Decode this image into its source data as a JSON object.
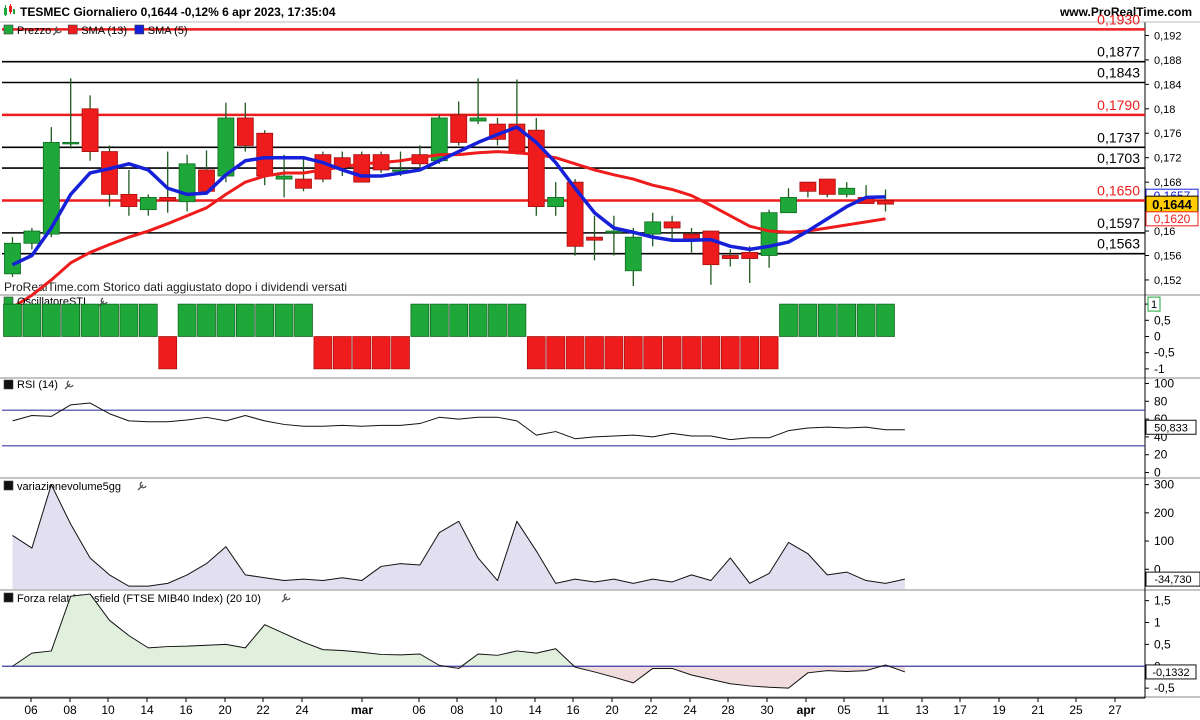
{
  "header": {
    "title": "TESMEC Giornaliero 0,1644 -0,12% 6 apr 2023, 17:35:04",
    "site": "www.ProRealTime.com"
  },
  "colors": {
    "up": "#1fa83a",
    "down": "#ee1c1c",
    "sma13": "#ee1c1c",
    "sma5": "#1520d8",
    "hline_red": "#ee1c1c",
    "hline_black": "#000000",
    "rsi_band": "#3a3aa0",
    "vol_fill": "#e2e0f0",
    "mansfield_pos": "#e0f0dc",
    "mansfield_neg": "#f0dcdc",
    "price_tag_bg": "#ffcc00"
  },
  "chart_data": [
    {
      "panel": "price",
      "type": "candlestick",
      "legend": [
        "Prezzo",
        "SMA (13)",
        "SMA (5)"
      ],
      "watermark": "ProRealTime.com Storico dati aggiustato dopo i dividendi versati",
      "y_ticks": [
        0.152,
        0.156,
        0.16,
        0.164,
        0.168,
        0.172,
        0.176,
        0.18,
        0.184,
        0.188,
        0.192
      ],
      "y_tick_labels": [
        "0,152",
        "0,156",
        "0,16",
        "0,164",
        "0,168",
        "0,172",
        "0,176",
        "0,18",
        "0,184",
        "0,188",
        "0,192"
      ],
      "ylim": [
        0.1497,
        0.1942
      ],
      "candles": [
        {
          "o": 0.153,
          "h": 0.159,
          "l": 0.1525,
          "c": 0.158
        },
        {
          "o": 0.158,
          "h": 0.1605,
          "l": 0.157,
          "c": 0.16
        },
        {
          "o": 0.1595,
          "h": 0.177,
          "l": 0.159,
          "c": 0.1745
        },
        {
          "o": 0.1745,
          "h": 0.185,
          "l": 0.1735,
          "c": 0.1745
        },
        {
          "o": 0.18,
          "h": 0.1822,
          "l": 0.1715,
          "c": 0.173
        },
        {
          "o": 0.173,
          "h": 0.174,
          "l": 0.164,
          "c": 0.166
        },
        {
          "o": 0.166,
          "h": 0.17,
          "l": 0.1625,
          "c": 0.164
        },
        {
          "o": 0.1635,
          "h": 0.166,
          "l": 0.1625,
          "c": 0.1655
        },
        {
          "o": 0.1655,
          "h": 0.173,
          "l": 0.163,
          "c": 0.165
        },
        {
          "o": 0.1648,
          "h": 0.1725,
          "l": 0.1632,
          "c": 0.171
        },
        {
          "o": 0.17,
          "h": 0.1732,
          "l": 0.1665,
          "c": 0.1665
        },
        {
          "o": 0.169,
          "h": 0.181,
          "l": 0.168,
          "c": 0.1785
        },
        {
          "o": 0.1785,
          "h": 0.181,
          "l": 0.173,
          "c": 0.174
        },
        {
          "o": 0.176,
          "h": 0.1765,
          "l": 0.1675,
          "c": 0.169
        },
        {
          "o": 0.1685,
          "h": 0.1725,
          "l": 0.1655,
          "c": 0.169
        },
        {
          "o": 0.1685,
          "h": 0.172,
          "l": 0.1665,
          "c": 0.167
        },
        {
          "o": 0.1725,
          "h": 0.173,
          "l": 0.168,
          "c": 0.1685
        },
        {
          "o": 0.172,
          "h": 0.173,
          "l": 0.169,
          "c": 0.1705
        },
        {
          "o": 0.1725,
          "h": 0.173,
          "l": 0.168,
          "c": 0.168
        },
        {
          "o": 0.1725,
          "h": 0.173,
          "l": 0.1695,
          "c": 0.17
        },
        {
          "o": 0.17,
          "h": 0.173,
          "l": 0.169,
          "c": 0.17
        },
        {
          "o": 0.1725,
          "h": 0.174,
          "l": 0.1705,
          "c": 0.171
        },
        {
          "o": 0.1715,
          "h": 0.179,
          "l": 0.171,
          "c": 0.1785
        },
        {
          "o": 0.179,
          "h": 0.1812,
          "l": 0.174,
          "c": 0.1745
        },
        {
          "o": 0.178,
          "h": 0.185,
          "l": 0.1775,
          "c": 0.1785
        },
        {
          "o": 0.1775,
          "h": 0.1785,
          "l": 0.174,
          "c": 0.175
        },
        {
          "o": 0.1775,
          "h": 0.1848,
          "l": 0.1725,
          "c": 0.173
        },
        {
          "o": 0.1765,
          "h": 0.1785,
          "l": 0.1625,
          "c": 0.164
        },
        {
          "o": 0.164,
          "h": 0.168,
          "l": 0.1625,
          "c": 0.1655
        },
        {
          "o": 0.168,
          "h": 0.1685,
          "l": 0.156,
          "c": 0.1575
        },
        {
          "o": 0.159,
          "h": 0.1625,
          "l": 0.1552,
          "c": 0.1585
        },
        {
          "o": 0.16,
          "h": 0.1625,
          "l": 0.156,
          "c": 0.16
        },
        {
          "o": 0.1535,
          "h": 0.1605,
          "l": 0.151,
          "c": 0.159
        },
        {
          "o": 0.1595,
          "h": 0.163,
          "l": 0.1575,
          "c": 0.1615
        },
        {
          "o": 0.1615,
          "h": 0.1625,
          "l": 0.1585,
          "c": 0.1605
        },
        {
          "o": 0.1595,
          "h": 0.1605,
          "l": 0.1565,
          "c": 0.1585
        },
        {
          "o": 0.16,
          "h": 0.16,
          "l": 0.1512,
          "c": 0.1545
        },
        {
          "o": 0.156,
          "h": 0.157,
          "l": 0.1542,
          "c": 0.1555
        },
        {
          "o": 0.1565,
          "h": 0.1575,
          "l": 0.1515,
          "c": 0.1555
        },
        {
          "o": 0.156,
          "h": 0.1635,
          "l": 0.154,
          "c": 0.163
        },
        {
          "o": 0.163,
          "h": 0.167,
          "l": 0.163,
          "c": 0.1655
        },
        {
          "o": 0.168,
          "h": 0.168,
          "l": 0.1655,
          "c": 0.1665
        },
        {
          "o": 0.1685,
          "h": 0.1685,
          "l": 0.1655,
          "c": 0.166
        },
        {
          "o": 0.166,
          "h": 0.168,
          "l": 0.1655,
          "c": 0.167
        },
        {
          "o": 0.1655,
          "h": 0.1675,
          "l": 0.1645,
          "c": 0.1645
        },
        {
          "o": 0.165,
          "h": 0.1668,
          "l": 0.1632,
          "c": 0.1644
        }
      ],
      "series": [
        {
          "name": "SMA (13)",
          "values": [
            0.1475,
            0.1495,
            0.152,
            0.1548,
            0.1565,
            0.1578,
            0.159,
            0.16,
            0.1612,
            0.1625,
            0.1638,
            0.166,
            0.168,
            0.169,
            0.1695,
            0.1695,
            0.17,
            0.1705,
            0.171,
            0.1712,
            0.1715,
            0.172,
            0.1725,
            0.1725,
            0.1728,
            0.173,
            0.1728,
            0.1725,
            0.172,
            0.171,
            0.17,
            0.1692,
            0.1685,
            0.1675,
            0.1668,
            0.1658,
            0.1642,
            0.1625,
            0.1608,
            0.16,
            0.1598,
            0.16,
            0.1605,
            0.161,
            0.1615,
            0.162
          ]
        },
        {
          "name": "SMA (5)",
          "values": [
            0.1545,
            0.156,
            0.1605,
            0.166,
            0.1695,
            0.1702,
            0.171,
            0.17,
            0.167,
            0.166,
            0.1662,
            0.1692,
            0.1715,
            0.172,
            0.172,
            0.172,
            0.1712,
            0.17,
            0.169,
            0.169,
            0.1695,
            0.17,
            0.1715,
            0.173,
            0.1745,
            0.1758,
            0.177,
            0.1745,
            0.1712,
            0.167,
            0.163,
            0.1605,
            0.1598,
            0.159,
            0.1585,
            0.1585,
            0.1586,
            0.1575,
            0.157,
            0.1575,
            0.1582,
            0.16,
            0.162,
            0.164,
            0.1655,
            0.1656
          ]
        }
      ],
      "hlines": [
        {
          "value": 0.193,
          "label": "0,1930",
          "color": "red"
        },
        {
          "value": 0.1877,
          "label": "0,1877",
          "color": "black"
        },
        {
          "value": 0.1843,
          "label": "0,1843",
          "color": "black"
        },
        {
          "value": 0.179,
          "label": "0,1790",
          "color": "red"
        },
        {
          "value": 0.1737,
          "label": "0,1737",
          "color": "black"
        },
        {
          "value": 0.1703,
          "label": "0,1703",
          "color": "black"
        },
        {
          "value": 0.165,
          "label": "0,1650",
          "color": "red"
        },
        {
          "value": 0.1597,
          "label": "0,1597",
          "color": "black"
        },
        {
          "value": 0.1563,
          "label": "0,1563",
          "color": "black"
        }
      ],
      "tags": [
        {
          "value": 0.1657,
          "label": "0,1657",
          "color": "blue"
        },
        {
          "value": 0.1644,
          "label": "0,1644",
          "color": "price"
        },
        {
          "value": 0.162,
          "label": "0,1620",
          "color": "red"
        }
      ]
    },
    {
      "panel": "oscillator",
      "type": "bar",
      "title": "OscillatoreSTI",
      "y_ticks": [
        1,
        0.5,
        0,
        -0.5,
        -1
      ],
      "y_tick_labels": [
        "1",
        "0,5",
        "0",
        "-0,5",
        "-1"
      ],
      "ylim": [
        -1.25,
        1.25
      ],
      "values": [
        1,
        1,
        1,
        1,
        1,
        1,
        1,
        1,
        -1,
        1,
        1,
        1,
        1,
        1,
        1,
        1,
        -1,
        -1,
        -1,
        -1,
        -1,
        1,
        1,
        1,
        1,
        1,
        1,
        -1,
        -1,
        -1,
        -1,
        -1,
        -1,
        -1,
        -1,
        -1,
        -1,
        -1,
        -1,
        -1,
        1,
        1,
        1,
        1,
        1,
        1
      ],
      "last_label": "1"
    },
    {
      "panel": "rsi",
      "type": "line",
      "title": "RSI (14)",
      "y_ticks": [
        100,
        80,
        60,
        50,
        40,
        20,
        0
      ],
      "y_tick_labels": [
        "100",
        "80",
        "60",
        "50",
        "40",
        "20",
        "0"
      ],
      "ylim": [
        -5,
        105
      ],
      "bands": [
        70,
        30
      ],
      "values": [
        58,
        64,
        63,
        76,
        78,
        66,
        58,
        57,
        57,
        59,
        62,
        58,
        64,
        58,
        54,
        52,
        52,
        53,
        52,
        53,
        53,
        55,
        62,
        60,
        62,
        62,
        58,
        42,
        46,
        38,
        40,
        41,
        42,
        40,
        44,
        41,
        41,
        37,
        39,
        39,
        47,
        50,
        51,
        50,
        51,
        48,
        48
      ],
      "last_label": "50,833"
    },
    {
      "panel": "volume_change",
      "type": "area",
      "title": "variazionevolume5gg",
      "y_ticks": [
        300,
        200,
        100,
        0
      ],
      "y_tick_labels": [
        "300",
        "200",
        "100",
        "0"
      ],
      "ylim": [
        -70,
        320
      ],
      "values": [
        120,
        75,
        300,
        160,
        40,
        -20,
        -60,
        -60,
        -50,
        -20,
        20,
        80,
        -20,
        -30,
        -40,
        -35,
        -40,
        -30,
        -40,
        10,
        20,
        15,
        130,
        170,
        40,
        -40,
        170,
        65,
        -50,
        -35,
        -45,
        -35,
        -50,
        -35,
        -45,
        -20,
        -40,
        40,
        -50,
        -15,
        95,
        55,
        -20,
        -10,
        -40,
        -50,
        -35
      ],
      "last_label": "-34,730"
    },
    {
      "panel": "mansfield",
      "type": "area",
      "title": "Forza relat Mansfield (FTSE MIB40 Index) (20 10)",
      "y_ticks": [
        1.5,
        1,
        0.5,
        0,
        -0.5
      ],
      "y_tick_labels": [
        "1,5",
        "1",
        "0,5",
        "0",
        "-0,5"
      ],
      "ylim": [
        -0.68,
        1.72
      ],
      "values": [
        0,
        0.3,
        0.35,
        1.6,
        1.65,
        1.05,
        0.7,
        0.42,
        0.45,
        0.46,
        0.48,
        0.5,
        0.42,
        0.95,
        0.75,
        0.55,
        0.38,
        0.36,
        0.32,
        0.27,
        0.26,
        0.28,
        0.02,
        -0.05,
        0.28,
        0.25,
        0.35,
        0.3,
        0.4,
        -0.02,
        -0.13,
        -0.25,
        -0.38,
        -0.05,
        -0.05,
        -0.2,
        -0.3,
        -0.4,
        -0.45,
        -0.48,
        -0.5,
        -0.15,
        -0.1,
        -0.12,
        -0.1,
        0.03,
        -0.13
      ],
      "last_label": "-0,1332"
    }
  ],
  "x_axis": {
    "labels": [
      "06",
      "08",
      "10",
      "14",
      "16",
      "20",
      "22",
      "24",
      "mar",
      "06",
      "08",
      "10",
      "14",
      "16",
      "20",
      "22",
      "24",
      "28",
      "30",
      "apr",
      "05",
      "11",
      "13",
      "17",
      "19",
      "21",
      "25",
      "27"
    ],
    "bold": [
      "mar",
      "apr"
    ]
  }
}
